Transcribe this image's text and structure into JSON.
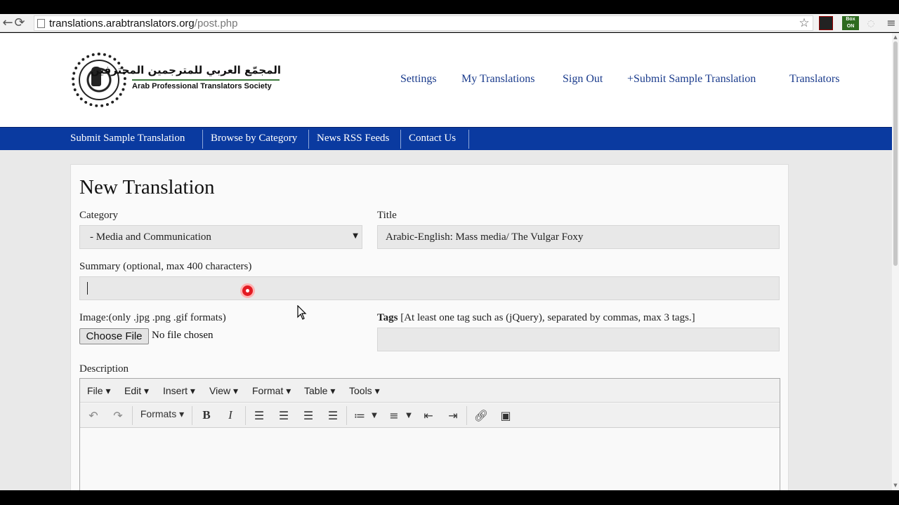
{
  "browser": {
    "url_host": "translations.arabtranslators.org",
    "url_path": "/post.php",
    "back_icon": "back-arrow-icon",
    "reload_icon": "reload-icon",
    "ext_badge": "Box ON"
  },
  "logo": {
    "arabic": "المجمّع العربي للمترجمين المحترفين",
    "english": "Arab Professional Translators Society"
  },
  "top_nav": [
    "Settings",
    "My Translations",
    "Sign Out",
    "+Submit Sample Translation",
    "Translators"
  ],
  "blue_nav": [
    "Submit Sample Translation",
    "Browse by Category",
    "News RSS Feeds",
    "Contact Us"
  ],
  "form": {
    "heading": "New Translation",
    "category_label": "Category",
    "category_value": "- Media and Communication",
    "title_label": "Title",
    "title_value": "Arabic-English: Mass media/ The Vulgar Foxy",
    "summary_label": "Summary (optional, max 400 characters)",
    "summary_value": "",
    "image_label": "Image:(only .jpg .png .gif formats)",
    "choose_file": "Choose File",
    "no_file": "No file chosen",
    "tags_label": "Tags",
    "tags_hint": "[At least one tag such as (jQuery), separated by commas, max 3 tags.]",
    "tags_value": "",
    "description_label": "Description"
  },
  "editor": {
    "menu": [
      "File",
      "Edit",
      "Insert",
      "View",
      "Format",
      "Table",
      "Tools"
    ],
    "formats_label": "Formats"
  },
  "colors": {
    "nav_blue": "#0a3aa0",
    "link_blue": "#1a3b8c",
    "record_red": "#e31b23"
  }
}
